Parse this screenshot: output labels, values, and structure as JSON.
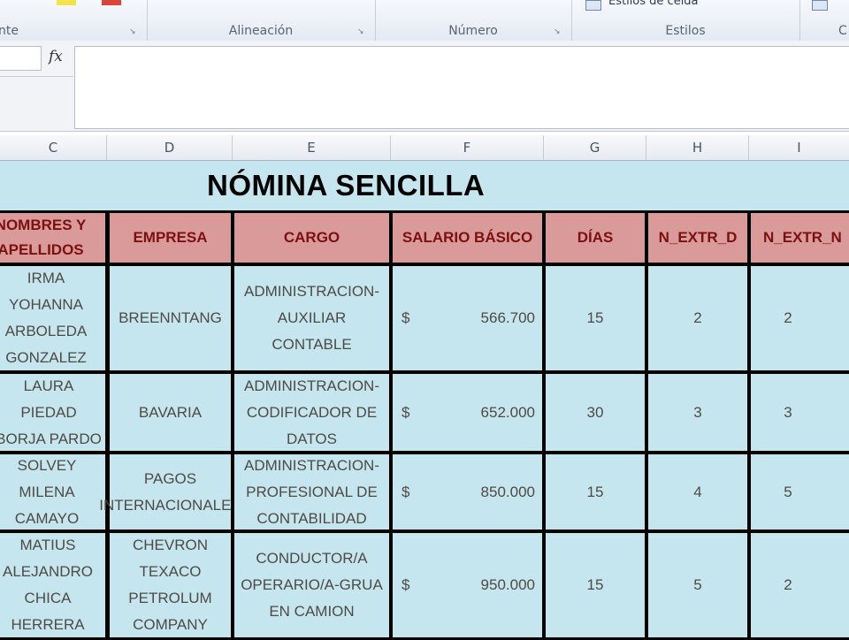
{
  "ribbon": {
    "groups": [
      {
        "label": "nte"
      },
      {
        "label": "Alineación"
      },
      {
        "label": "Número"
      },
      {
        "label": "Estilos",
        "button": "Estilos de celda"
      },
      {
        "label": "C"
      }
    ],
    "launcher_glyph": "↘",
    "colors": {
      "swatch_yellow": "#f4e24a",
      "swatch_red": "#d9443b"
    }
  },
  "formula_bar": {
    "fx_label": "fx",
    "value": ""
  },
  "columns": [
    "C",
    "D",
    "E",
    "F",
    "G",
    "H",
    "I"
  ],
  "sheet": {
    "title": "NÓMINA SENCILLA",
    "headers": [
      "NOMBRES Y APELLIDOS",
      "EMPRESA",
      "CARGO",
      "SALARIO BÁSICO",
      "DÍAS",
      "N_EXTR_D",
      "N_EXTR_N"
    ],
    "rows": [
      {
        "nombre": "IRMA YOHANNA ARBOLEDA GONZALEZ",
        "empresa": "BREENNTANG",
        "cargo": "ADMINISTRACION-AUXILIAR CONTABLE",
        "moneda": "$",
        "salario": "566.700",
        "dias": "15",
        "extr_d": "2",
        "extr_n": "2"
      },
      {
        "nombre": "LAURA PIEDAD BORJA PARDO",
        "empresa": "BAVARIA",
        "cargo": "ADMINISTRACION-CODIFICADOR DE DATOS",
        "moneda": "$",
        "salario": "652.000",
        "dias": "30",
        "extr_d": "3",
        "extr_n": "3"
      },
      {
        "nombre": "SOLVEY MILENA CAMAYO",
        "empresa": "PAGOS INTERNACIONALES",
        "cargo": "ADMINISTRACION-PROFESIONAL DE CONTABILIDAD",
        "moneda": "$",
        "salario": "850.000",
        "dias": "15",
        "extr_d": "4",
        "extr_n": "5"
      },
      {
        "nombre": "MATIUS ALEJANDRO CHICA HERRERA",
        "empresa": "CHEVRON TEXACO PETROLUM COMPANY",
        "cargo": "CONDUCTOR/A OPERARIO/A-GRUA EN CAMION",
        "moneda": "$",
        "salario": "950.000",
        "dias": "15",
        "extr_d": "5",
        "extr_n": "2"
      }
    ],
    "colors": {
      "sheet_bg": "#c5e6ef",
      "header_bg": "#db9a9a",
      "header_text": "#7a1010"
    }
  }
}
